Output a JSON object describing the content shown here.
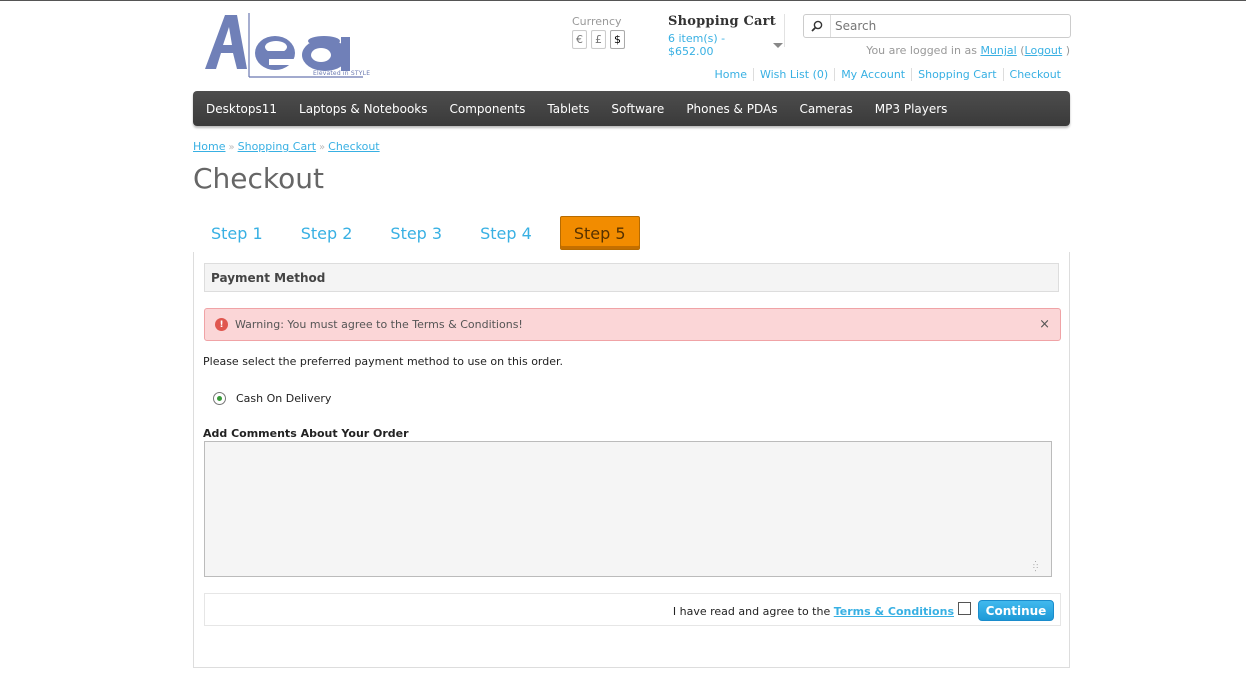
{
  "logo": {
    "text": "Aea",
    "tagline": "Elevated in STYLE"
  },
  "currency": {
    "label": "Currency",
    "options": [
      "€",
      "£",
      "$"
    ],
    "selected": "$"
  },
  "cart": {
    "title": "Shopping Cart",
    "summary": "6 item(s) - $652.00"
  },
  "search": {
    "placeholder": "Search"
  },
  "welcome": {
    "prefix": "You are logged in as",
    "username": "Munjal",
    "open_paren": "(",
    "logout": "Logout",
    "close_paren": ")"
  },
  "top_links": [
    "Home",
    "Wish List (0)",
    "My Account",
    "Shopping Cart",
    "Checkout"
  ],
  "menu": [
    "Desktops11",
    "Laptops & Notebooks",
    "Components",
    "Tablets",
    "Software",
    "Phones & PDAs",
    "Cameras",
    "MP3 Players"
  ],
  "breadcrumb": {
    "items": [
      "Home",
      "Shopping Cart",
      "Checkout"
    ],
    "separator": "»"
  },
  "page_title": "Checkout",
  "steps": [
    "Step 1",
    "Step 2",
    "Step 3",
    "Step 4",
    "Step 5"
  ],
  "active_step": "Step 5",
  "payment": {
    "heading": "Payment Method",
    "warning": "Warning: You must agree to the Terms & Conditions!",
    "warning_close": "×",
    "intro": "Please select the preferred payment method to use on this order.",
    "method": "Cash On Delivery",
    "comments_label": "Add Comments About Your Order",
    "comments_value": "",
    "agree_text": "I have read and agree to the",
    "terms_link": "Terms & Conditions",
    "continue": "Continue"
  },
  "colors": {
    "link": "#38b0e3",
    "menu_bg": "#444444",
    "active_step": "#f28c00",
    "warning_bg": "#fbd6d7",
    "button": "#1d9ad7"
  }
}
